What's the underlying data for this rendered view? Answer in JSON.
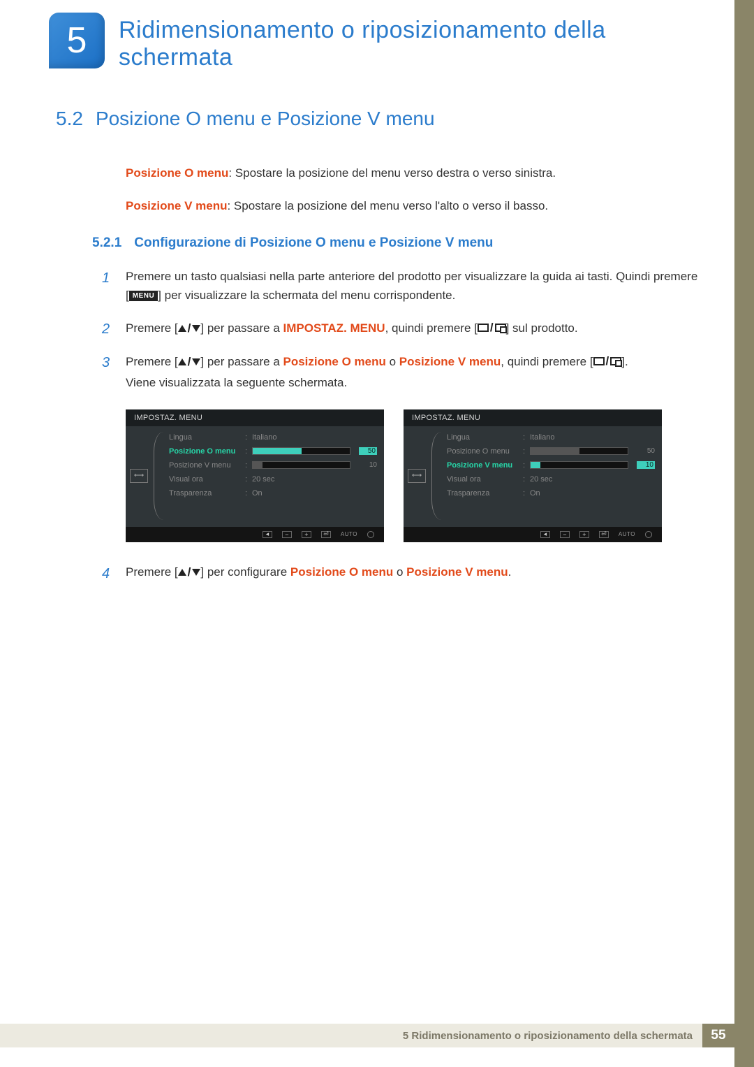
{
  "chapter_number": "5",
  "chapter_title": "Ridimensionamento o riposizionamento della schermata",
  "section": {
    "num": "5.2",
    "title": "Posizione O menu e Posizione V menu"
  },
  "intro": {
    "p1_label": "Posizione O menu",
    "p1_text": ": Spostare la posizione del menu verso destra o verso sinistra.",
    "p2_label": "Posizione V menu",
    "p2_text": ": Spostare la posizione del menu verso l'alto o verso il basso."
  },
  "subsection": {
    "num": "5.2.1",
    "title": "Configurazione di Posizione O menu e Posizione V menu"
  },
  "steps": {
    "s1a": "Premere un tasto qualsiasi nella parte anteriore del prodotto per visualizzare la guida ai tasti. Quindi premere [",
    "s1_menu": "MENU",
    "s1b": "] per visualizzare la schermata del menu corrispondente.",
    "s2a": "Premere [",
    "s2b": "] per passare a ",
    "s2_hl": "IMPOSTAZ. MENU",
    "s2c": ", quindi premere [",
    "s2d": "] sul prodotto.",
    "s3a": "Premere [",
    "s3b": "] per passare a ",
    "s3_hl1": "Posizione O menu",
    "s3_mid": " o ",
    "s3_hl2": "Posizione V menu",
    "s3c": ", quindi premere [",
    "s3d": "].",
    "s3e": "Viene visualizzata la seguente schermata.",
    "s4a": "Premere [",
    "s4b": "] per configurare ",
    "s4_hl1": "Posizione O menu",
    "s4_mid": " o ",
    "s4_hl2": "Posizione V menu",
    "s4c": "."
  },
  "osd": {
    "title": "IMPOSTAZ. MENU",
    "items": {
      "lang_label": "Lingua",
      "lang_val": "Italiano",
      "poso_label": "Posizione O menu",
      "poso_val": "50",
      "posv_label": "Posizione V menu",
      "posv_val": "10",
      "time_label": "Visual ora",
      "time_val": "20 sec",
      "trans_label": "Trasparenza",
      "trans_val": "On"
    },
    "bar_auto": "AUTO"
  },
  "footer": {
    "label": "5 Ridimensionamento o riposizionamento della schermata",
    "page": "55"
  }
}
